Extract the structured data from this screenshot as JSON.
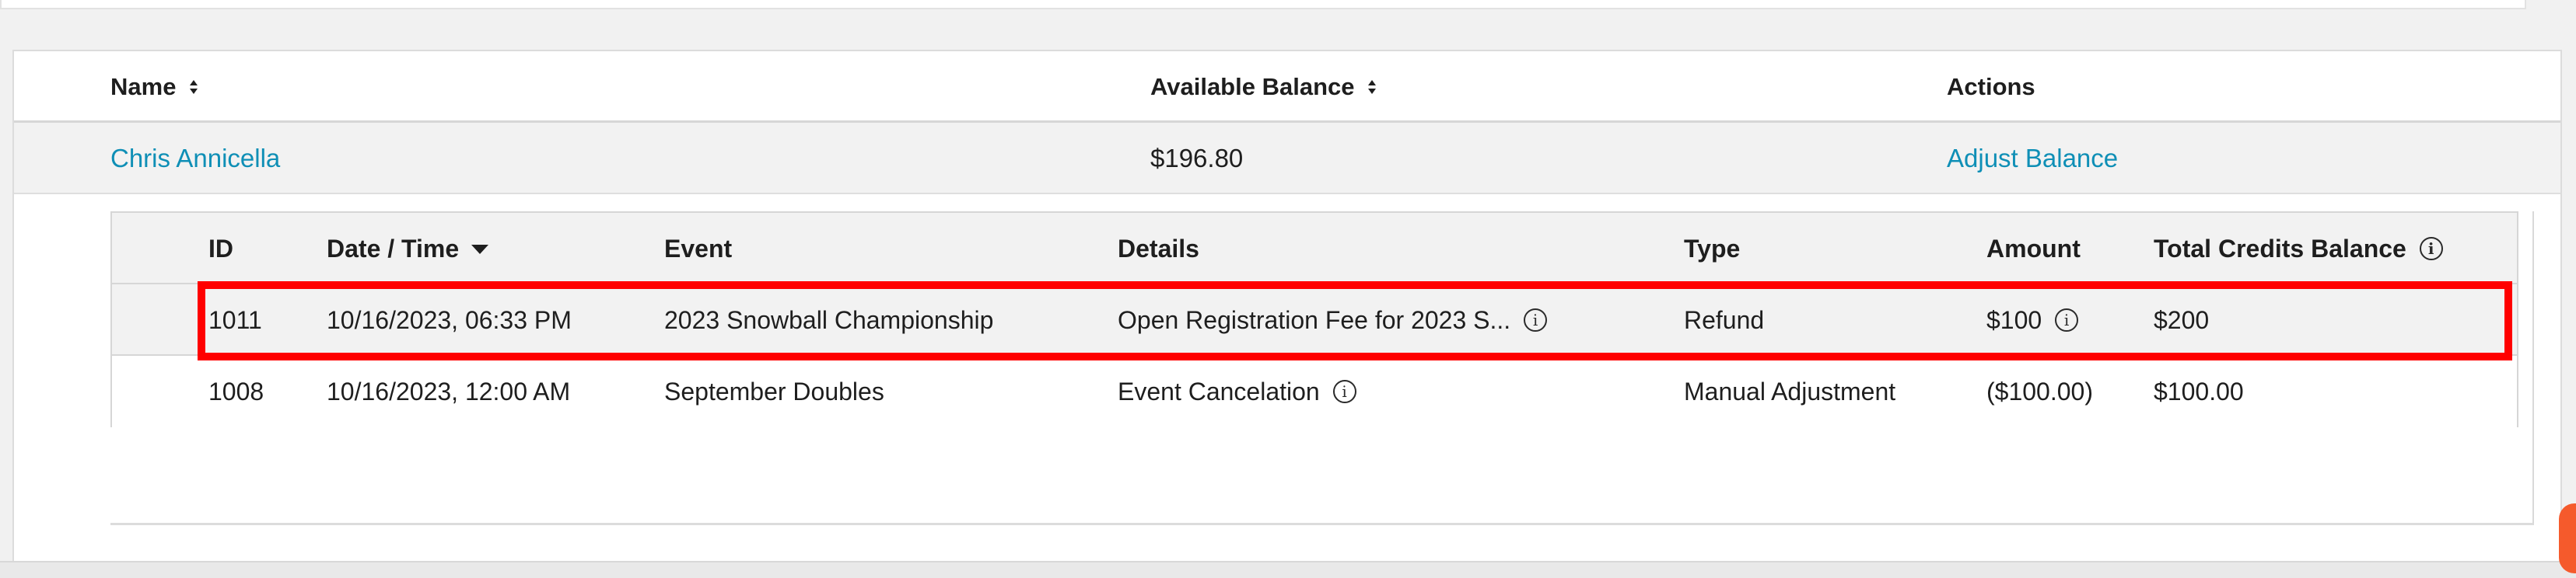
{
  "outer_table": {
    "headers": {
      "name": "Name",
      "available_balance": "Available Balance",
      "actions": "Actions"
    },
    "row": {
      "name": "Chris Annicella",
      "available_balance": "$196.80",
      "action": "Adjust Balance"
    }
  },
  "inner_table": {
    "headers": {
      "id": "ID",
      "date_time": "Date / Time",
      "event": "Event",
      "details": "Details",
      "type": "Type",
      "amount": "Amount",
      "total_credits_balance": "Total Credits Balance"
    },
    "rows": [
      {
        "id": "1011",
        "date_time": "10/16/2023, 06:33 PM",
        "event": "2023 Snowball Championship",
        "details": "Open Registration Fee for 2023 S...",
        "type": "Refund",
        "amount": "$100",
        "total_credits_balance": "$200"
      },
      {
        "id": "1008",
        "date_time": "10/16/2023, 12:00 AM",
        "event": "September Doubles",
        "details": "Event Cancelation",
        "type": "Manual Adjustment",
        "amount": "($100.00)",
        "total_credits_balance": "$100.00"
      }
    ]
  },
  "icons": {
    "sort": "sort-icon",
    "sort_desc": "caret-down-icon",
    "info": "info-icon"
  },
  "colors": {
    "link": "#0f8fb6",
    "highlight": "#ff0000",
    "accent": "#f55a2c"
  }
}
